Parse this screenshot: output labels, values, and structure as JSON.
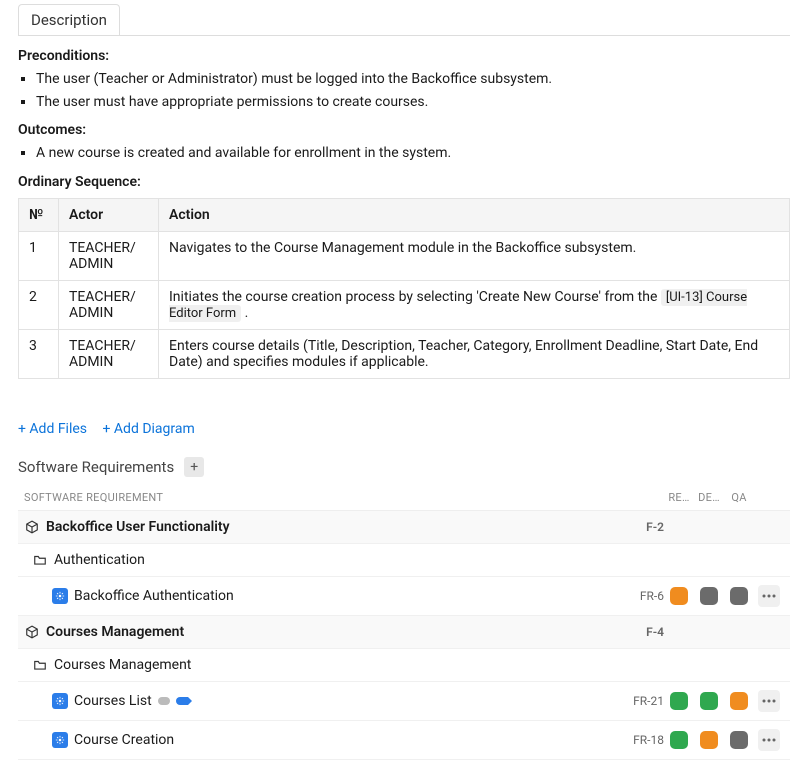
{
  "description": {
    "tab_label": "Description",
    "preconditions_heading": "Preconditions:",
    "preconditions": [
      "The user (Teacher or Administrator) must be logged into the Backoffice subsystem.",
      "The user must have appropriate permissions to create courses."
    ],
    "outcomes_heading": "Outcomes:",
    "outcomes": [
      "A new course is created and available for enrollment in the system."
    ],
    "ordinary_heading": "Ordinary Sequence:",
    "table": {
      "headers": {
        "num": "№",
        "actor": "Actor",
        "action": "Action"
      },
      "rows": [
        {
          "num": "1",
          "actor": "TEACHER/ ADMIN",
          "action_pre": "Navigates to the Course Management module in the Backoffice subsystem.",
          "chip": "",
          "action_post": ""
        },
        {
          "num": "2",
          "actor": "TEACHER/ ADMIN",
          "action_pre": "Initiates the course creation process by selecting 'Create New Course' from the ",
          "chip": "[UI-13] Course Editor Form",
          "action_post": " ."
        },
        {
          "num": "3",
          "actor": "TEACHER/ ADMIN",
          "action_pre": "Enters course details (Title, Description, Teacher, Category, Enrollment Deadline, Start Date, End Date) and specifies modules if applicable.",
          "chip": "",
          "action_post": ""
        }
      ]
    }
  },
  "links": {
    "add_files": "+ Add Files",
    "add_diagram": "+ Add Diagram"
  },
  "requirements": {
    "title": "Software Requirements",
    "columns": {
      "main": "SOFTWARE REQUIREMENT",
      "id": "",
      "re": "RE…",
      "de": "DE…",
      "qa": "QA"
    },
    "rows": {
      "g1_label": "Backoffice User Functionality",
      "g1_id": "F-2",
      "f1_label": "Authentication",
      "l1_label": "Backoffice Authentication",
      "l1_id": "FR-6",
      "g2_label": "Courses Management",
      "g2_id": "F-4",
      "f2_label": "Courses Management",
      "l2_label": "Courses List",
      "l2_id": "FR-21",
      "l3_label": "Course Creation",
      "l3_id": "FR-18"
    }
  }
}
